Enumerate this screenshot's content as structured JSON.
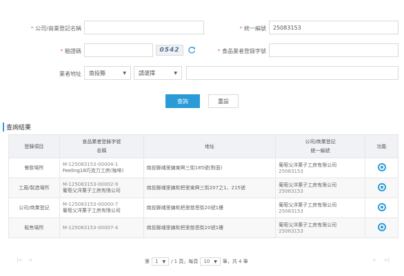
{
  "form": {
    "company_label_req": "*",
    "company_label": "公司/商業登記名稱",
    "company_value": "",
    "id_label_req": "*",
    "id_label": "統一編號",
    "id_value": "25083153",
    "captcha_label_req": "*",
    "captcha_label": "驗證碼",
    "captcha_value": "",
    "captcha_code": "0542",
    "regno_label_req": "*",
    "regno_label": "食品業者登錄字號",
    "regno_value": "",
    "addr_label": "業者地址",
    "county_value": "南投縣",
    "district_value": "請選擇",
    "addr_value": "",
    "query_label": "查詢",
    "reset_label": "重設"
  },
  "results": {
    "title": "查詢結果",
    "headers": {
      "item": "登錄項目",
      "regno_top": "食品業者登錄字號",
      "regno_bottom": "名稱",
      "address": "地址",
      "company_top": "公司/商業登記",
      "company_bottom": "統一編號",
      "action": "功能"
    },
    "rows": [
      {
        "item": "餐飲場所",
        "regno": "M-125083153-00004-1",
        "name": "Feeling18巧克力工房(咖啡)",
        "address": "南投縣埔里鎮東興三街185號(對面)",
        "company": "葡萄父洋菓子工房有限公司",
        "taxid": "25083153"
      },
      {
        "item": "工廠/製造場所",
        "regno": "M-125083153-00002-9",
        "name": "葡萄父洋菓子工房有限公司",
        "address": "南投縣埔里鎮枇杷里東興三街207之1、215號",
        "company": "葡萄父洋菓子工房有限公司",
        "taxid": "25083153"
      },
      {
        "item": "公司/商業登記",
        "regno": "M-125083153-00000-7",
        "name": "葡萄父洋菓子工房有限公司",
        "address": "南投縣埔里鎮枇杷里慈恩街20號1樓",
        "company": "葡萄父洋菓子工房有限公司",
        "taxid": "25083153"
      },
      {
        "item": "販售場所",
        "regno": "M-125083153-00007-4",
        "name": "",
        "address": "南投縣埔里鎮枇杷里慈恩街20號1樓",
        "company": "葡萄父洋菓子工房有限公司",
        "taxid": "25083153"
      }
    ]
  },
  "pager": {
    "first": "|<",
    "prev": "<",
    "next": ">",
    "last": ">|",
    "pre_text": "第",
    "page_value": "1",
    "mid_text": "/ 1 頁，每頁",
    "size_value": "10",
    "post_text": "筆，共 4 筆"
  },
  "colors": {
    "accent": "#2b9bd8"
  }
}
